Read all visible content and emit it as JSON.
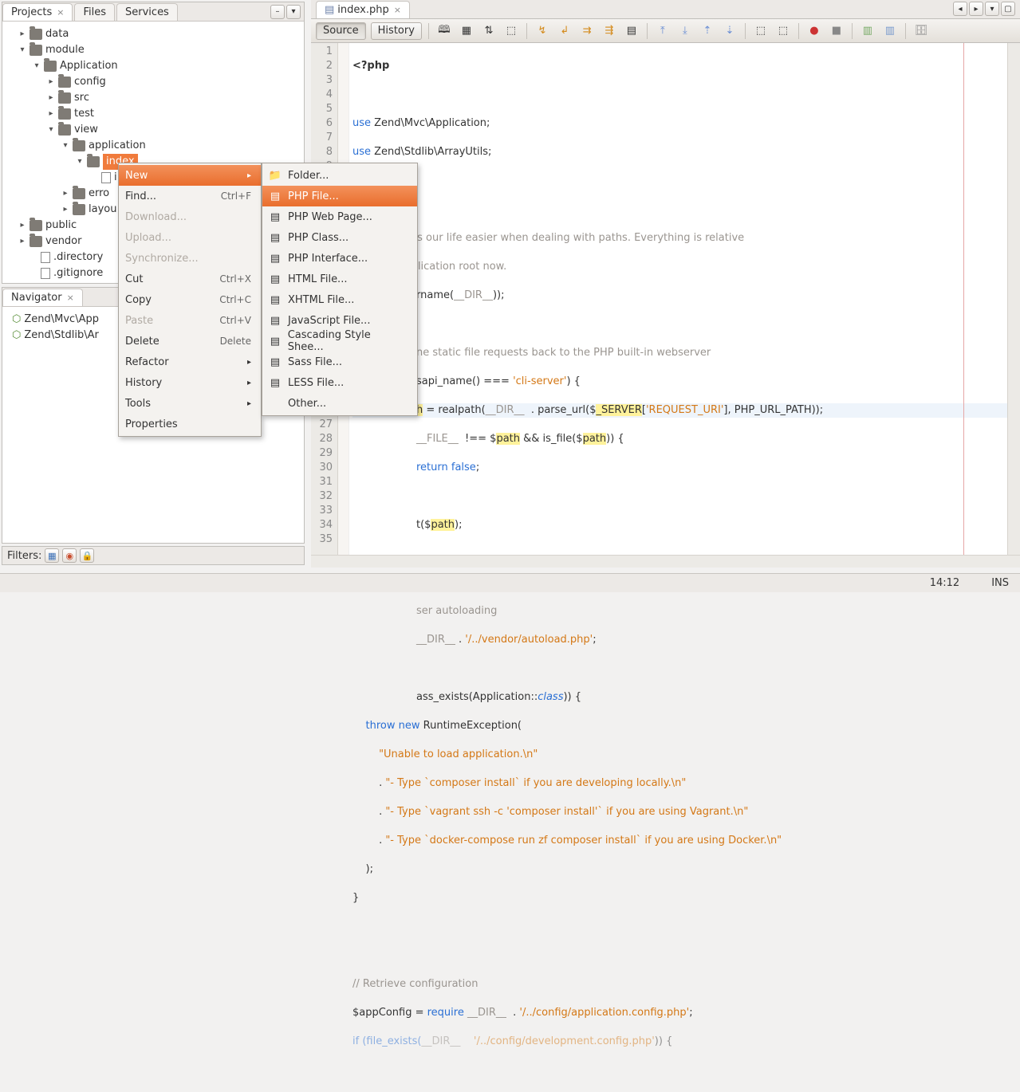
{
  "left_tabs": {
    "projects": "Projects",
    "files": "Files",
    "services": "Services",
    "navigator": "Navigator"
  },
  "tree": {
    "data": "data",
    "module": "module",
    "application_pkg": "Application",
    "config": "config",
    "src": "src",
    "test": "test",
    "view": "view",
    "application": "application",
    "index": "index",
    "i": "i",
    "error": "erro",
    "layout": "layou",
    "public": "public",
    "vendor": "vendor",
    "directory": ".directory",
    "gitignore": ".gitignore"
  },
  "navigator": {
    "ns1": "Zend\\Mvc\\App",
    "ns2": "Zend\\Stdlib\\Ar"
  },
  "filters_label": "Filters:",
  "file_tab": "index.php",
  "src_history": {
    "source": "Source",
    "history": "History"
  },
  "ctx": {
    "new": "New",
    "find": "Find...",
    "find_sc": "Ctrl+F",
    "download": "Download...",
    "upload": "Upload...",
    "sync": "Synchronize...",
    "cut": "Cut",
    "cut_sc": "Ctrl+X",
    "copy": "Copy",
    "copy_sc": "Ctrl+C",
    "paste": "Paste",
    "paste_sc": "Ctrl+V",
    "delete": "Delete",
    "delete_sc": "Delete",
    "refactor": "Refactor",
    "history": "History",
    "tools": "Tools",
    "props": "Properties"
  },
  "newmenu": {
    "folder": "Folder...",
    "php_file": "PHP File...",
    "php_web": "PHP Web Page...",
    "php_class": "PHP Class...",
    "php_if": "PHP Interface...",
    "html": "HTML File...",
    "xhtml": "XHTML File...",
    "js": "JavaScript File...",
    "css": "Cascading Style Shee...",
    "sass": "Sass File...",
    "less": "LESS File...",
    "other": "Other..."
  },
  "status": {
    "time": "14:12",
    "ins": "INS"
  },
  "code": {
    "l1a": "<?php",
    "l3a": "use",
    "l3b": " Zend\\Mvc\\Application;",
    "l4a": "use",
    "l4b": " Zend\\Stdlib\\ArrayUtils;",
    "l6": "/**",
    "l7": " * This makes our life easier when dealing with paths. Everything is relative",
    "l8": " * to the application root now.",
    "l9": "rname(",
    "l9b": "__DIR__",
    "l9c": "));",
    "l11": "ne static file requests back to the PHP built-in webserver",
    "l12a": "sapi_name() === ",
    "l12b": "'cli-server'",
    "l12c": ") {",
    "l13a": "h",
    "l13b": " = realpath(",
    "l13c": "__DIR__",
    "l13d": "  . parse_url($",
    "l13e": "_SERVER",
    "l13f": "[",
    "l13g": "'REQUEST_URI'",
    "l13h": "], PHP_URL_PATH));",
    "l14a": "__FILE__",
    "l14b": "  !== $",
    "l14c": "path",
    "l14d": " && is_file($",
    "l14e": "path",
    "l14f": ")) {",
    "l15a": "return false",
    "l15b": ";",
    "l17a": "t($",
    "l17b": "path",
    "l17c": ");",
    "l20": "ser autoloading",
    "l21a": "__DIR__",
    "l21b": " . ",
    "l21c": "'/../vendor/autoload.php'",
    "l21d": ";",
    "l23a": "ass_exists(Application::",
    "l23b": "class",
    "l23c": ")) {",
    "l24a": "throw new ",
    "l24b": "RuntimeException(",
    "l25": "\"Unable to load application.\\n\"",
    "l26a": ". ",
    "l26b": "\"- Type `composer install` if you are developing locally.\\n\"",
    "l27a": ". ",
    "l27b": "\"- Type `vagrant ssh -c 'composer install'` if you are using Vagrant.\\n\"",
    "l28a": ". ",
    "l28b": "\"- Type `docker-compose run zf composer install` if you are using Docker.\\n\"",
    "l29": ");",
    "l30": "}",
    "l33": "// Retrieve configuration",
    "l34a": "$appConfig = ",
    "l34b": "require ",
    "l34c": "__DIR__",
    "l34d": "  . ",
    "l34e": "'/../config/application.config.php'",
    "l34f": ";",
    "l35a": "if (file_exists(",
    "l35b": "__DIR__",
    "l35c": "    ",
    "l35d": "'/../config/development.config.php'",
    "l35e": ")) {"
  }
}
